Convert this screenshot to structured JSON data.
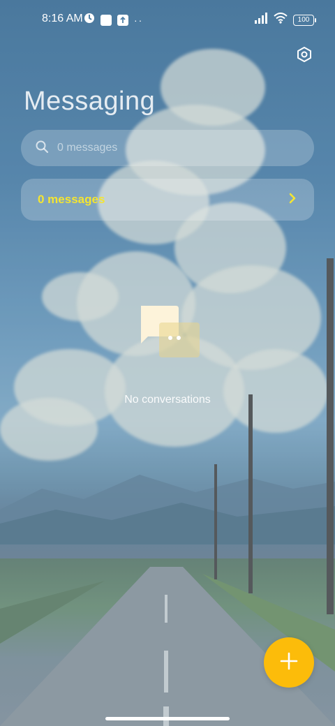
{
  "status_bar": {
    "time": "8:16 AM",
    "battery": "100",
    "more": "··",
    "icons": [
      "clock-status-icon",
      "notification-square-icon",
      "upload-icon",
      "signal-icon",
      "wifi-icon",
      "battery-icon"
    ]
  },
  "header": {
    "title": "Messaging",
    "settings_icon": "settings-hex-icon"
  },
  "search": {
    "placeholder": "0 messages",
    "value": ""
  },
  "messages_card": {
    "label": "0 messages",
    "accent_color": "#f4e531"
  },
  "empty_state": {
    "text": "No conversations",
    "icon": "chat-bubbles-icon"
  },
  "fab": {
    "icon": "plus-icon",
    "color": "#fcbc0a"
  }
}
